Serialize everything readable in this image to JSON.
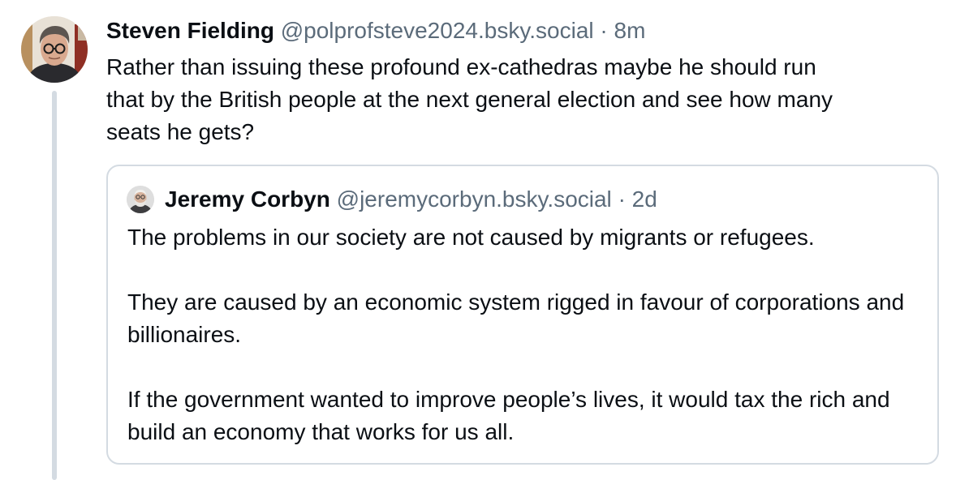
{
  "post": {
    "author_name": "Steven Fielding",
    "author_handle": "@polprofsteve2024.bsky.social",
    "separator": "·",
    "time": "8m",
    "avatar_icon": "person-with-glasses-avatar-icon",
    "text": "Rather than issuing these profound ex-cathedras maybe he should run\nthat by the British people at the next general election and see how many\nseats he gets?"
  },
  "quote": {
    "author_name": "Jeremy Corbyn",
    "author_handle": "@jeremycorbyn.bsky.social",
    "separator": "·",
    "time": "2d",
    "avatar_icon": "bearded-man-avatar-icon",
    "paragraphs": [
      "The problems in our society are not caused by migrants or refugees.",
      "They are caused by an economic system rigged in favour of corporations and billionaires.",
      "If the government wanted to improve people’s lives, it would tax the rich and build an economy that works for us all."
    ]
  },
  "colors": {
    "text": "#0b0f14",
    "muted": "#5b6b7a",
    "border": "#d4dbe2",
    "thread_line": "#d4dbe2"
  }
}
